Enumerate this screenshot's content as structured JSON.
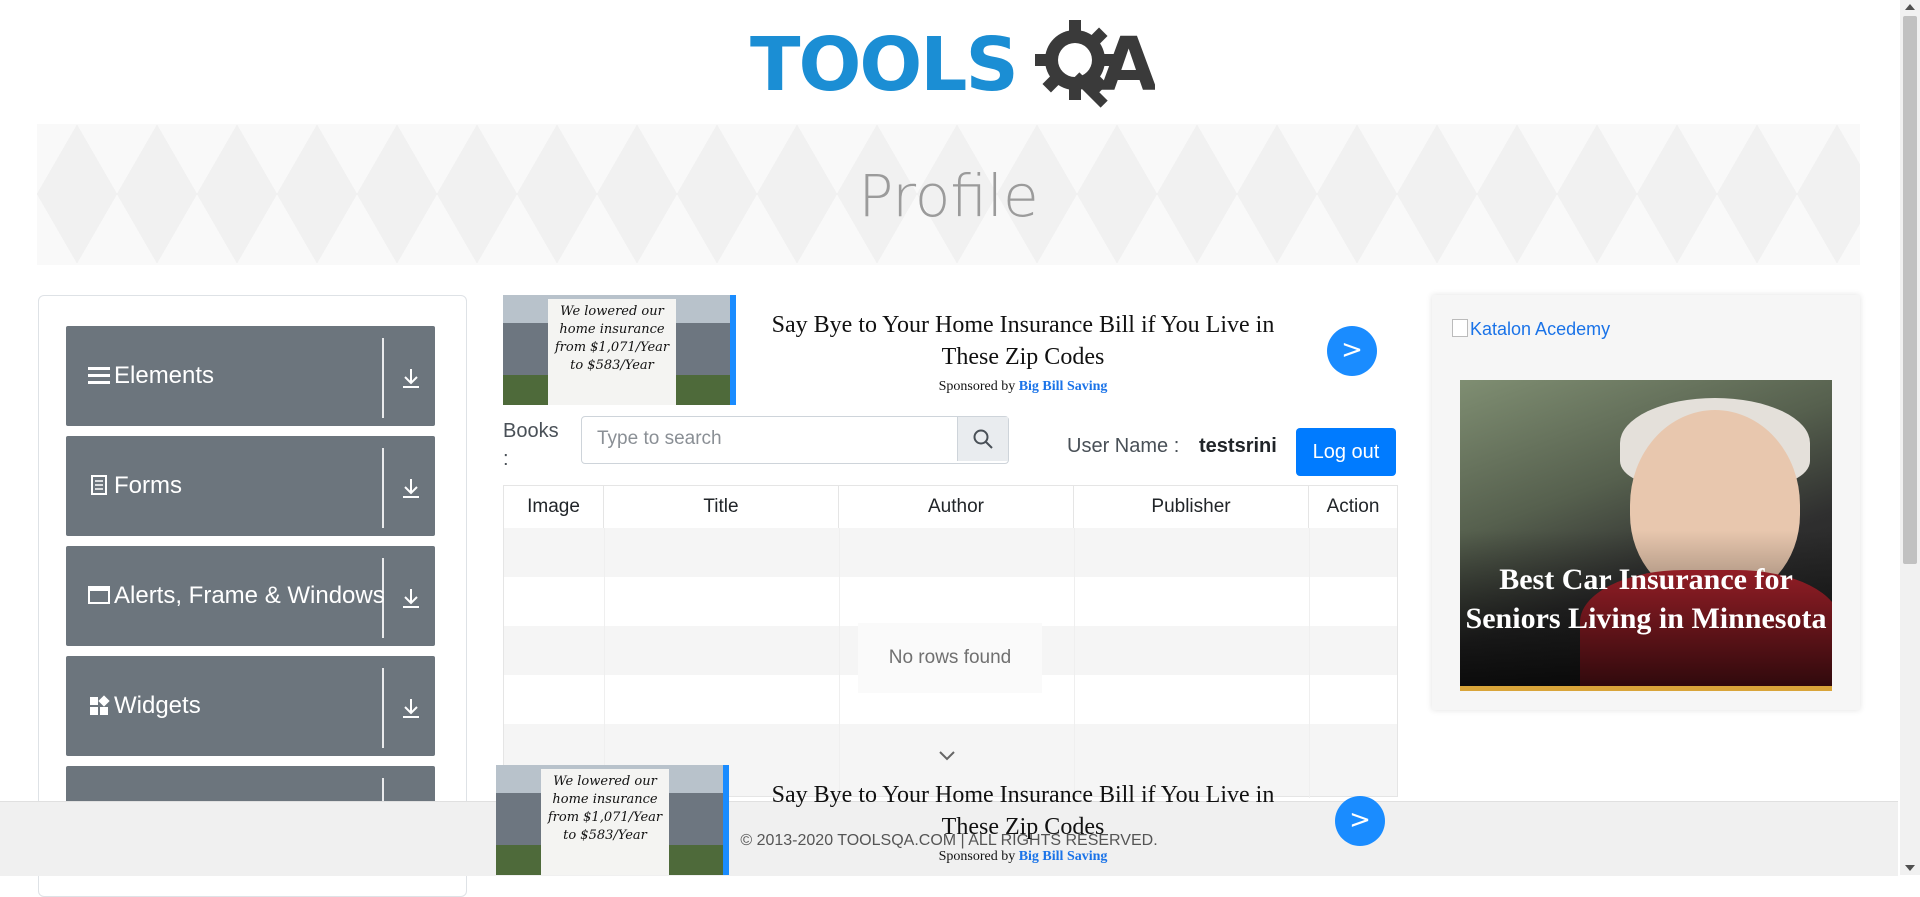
{
  "header": {
    "logo_text": "TOOLSQA"
  },
  "page_title": "Profile",
  "sidebar": {
    "groups": [
      {
        "label": "Elements",
        "icon": "hamburger-icon"
      },
      {
        "label": "Forms",
        "icon": "document-icon"
      },
      {
        "label": "Alerts, Frame & Windows",
        "icon": "window-icon"
      },
      {
        "label": "Widgets",
        "icon": "widgets-icon"
      },
      {
        "label": "",
        "icon": ""
      }
    ]
  },
  "ad_top": {
    "image_text": "We lowered our home insurance from $1,071/Year to $583/Year",
    "headline": "Say Bye to Your Home Insurance Bill if You Live in These Zip Codes",
    "sponsored_prefix": "Sponsored by",
    "sponsor": "Big Bill Saving",
    "go_label": ">"
  },
  "books": {
    "label": "Books :",
    "search_placeholder": "Type to search"
  },
  "user": {
    "label": "User Name :",
    "value": "testsrini",
    "logout_label": "Log out"
  },
  "table": {
    "headers": [
      "Image",
      "Title",
      "Author",
      "Publisher",
      "Action"
    ],
    "empty_message": "No rows found"
  },
  "right_ad": {
    "link_text": "Katalon Acedemy",
    "caption": "Best Car Insurance for Seniors Living in Minnesota"
  },
  "footer": {
    "copyright": "© 2013-2020 TOOLSQA.COM | ALL RIGHTS RESERVED."
  },
  "ad_bottom": {
    "image_text": "We lowered our home insurance from $1,071/Year to $583/Year",
    "headline": "Say Bye to Your Home Insurance Bill if You Live in These Zip Codes",
    "sponsored_prefix": "Sponsored by",
    "sponsor": "Big Bill Saving",
    "go_label": ">"
  },
  "colors": {
    "primary": "#007bff",
    "sidebar_group": "#6c757d",
    "logo_blue": "#1b8ed4",
    "logo_dark": "#3a3a3a"
  }
}
